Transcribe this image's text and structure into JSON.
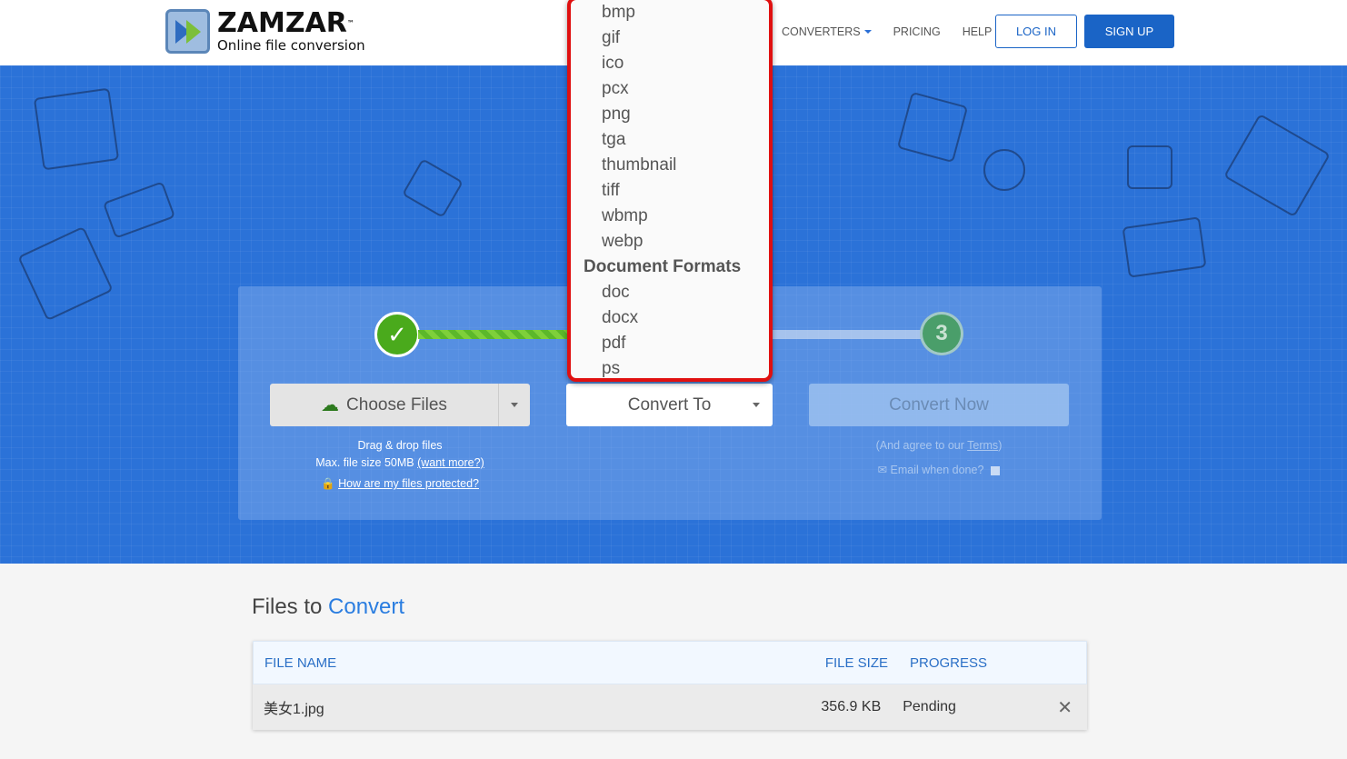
{
  "header": {
    "brand": "ZAMZAR",
    "tm": "™",
    "tagline": "Online file conversion",
    "nav": [
      {
        "label": "CONVERTERS"
      },
      {
        "label": "PRICING"
      },
      {
        "label": "HELP"
      }
    ],
    "login": "LOG IN",
    "signup": "SIGN UP"
  },
  "steps": {
    "step1": "✓",
    "step3": "3"
  },
  "uploader": {
    "choose_files": "Choose Files",
    "convert_to": "Convert To",
    "convert_now": "Convert Now",
    "drag_drop": "Drag & drop files",
    "max_size": "Max. file size 50MB ",
    "want_more": "(want more?)",
    "protected": "How are my files protected?",
    "agree_prefix": "(And agree to our ",
    "terms": "Terms",
    "agree_suffix": ")",
    "email": "Email when done?"
  },
  "dropdown": {
    "image_items": [
      "bmp",
      "gif",
      "ico",
      "pcx",
      "png",
      "tga",
      "thumbnail",
      "tiff",
      "wbmp",
      "webp"
    ],
    "group": "Document Formats",
    "doc_items": [
      "doc",
      "docx",
      "pdf",
      "ps"
    ]
  },
  "files": {
    "title_a": "Files to ",
    "title_b": "Convert",
    "columns": [
      "FILE NAME",
      "FILE SIZE",
      "PROGRESS"
    ],
    "rows": [
      {
        "name": "美女1.jpg",
        "size": "356.9 KB",
        "progress": "Pending"
      }
    ]
  },
  "colors": {
    "accent": "#1a64c6",
    "hero": "#2b72d8",
    "dropdown_border": "#e01010",
    "success": "#4aaa1c"
  }
}
